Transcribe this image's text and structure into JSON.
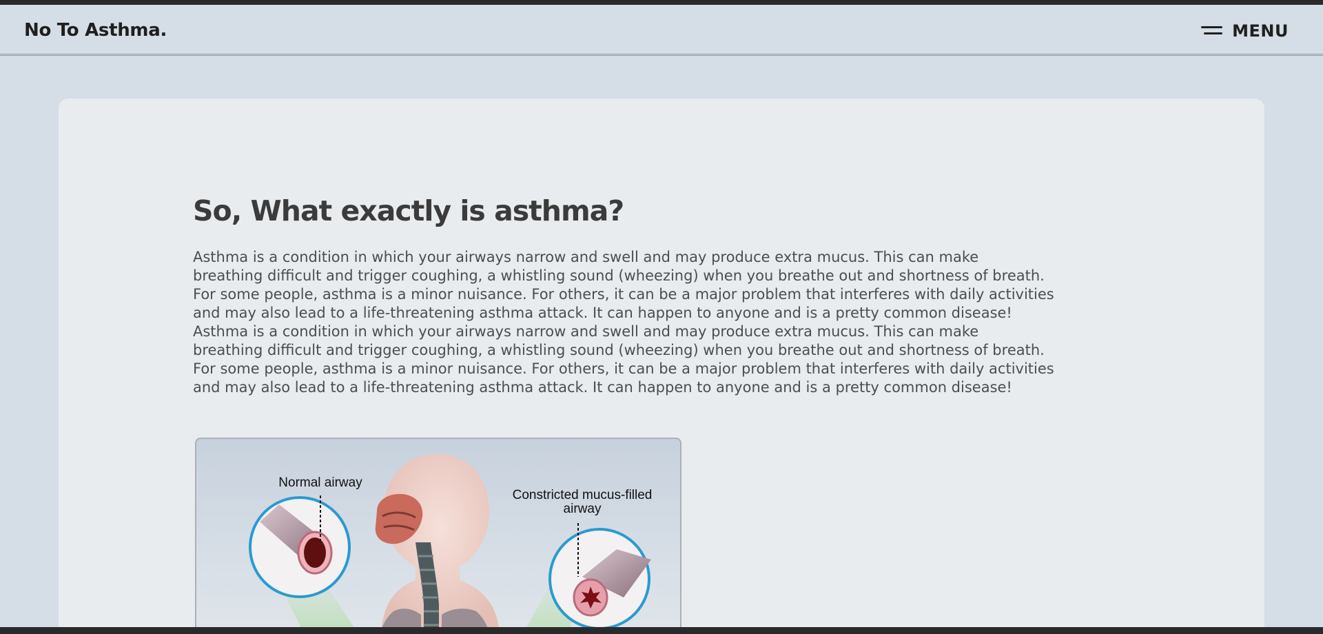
{
  "header": {
    "brand": "No To Asthma.",
    "menu_label": "MENU",
    "menu_icon": "hamburger-menu-icon"
  },
  "main": {
    "title": "So, What exactly is asthma?",
    "paragraph_lines": [
      "Asthma is a condition in which your airways narrow and swell and may produce extra mucus. This can make",
      "breathing difficult and trigger coughing, a whistling sound (wheezing) when you breathe out and shortness of breath.",
      "For some people, asthma is a minor nuisance. For others, it can be a major problem that interferes with daily activities",
      "and may also lead to a life-threatening asthma attack. It can happen to anyone and is a pretty common disease!",
      "Asthma is a condition in which your airways narrow and swell and may produce extra mucus. This can make",
      "breathing difficult and trigger coughing, a whistling sound (wheezing) when you breathe out and shortness of breath.",
      "For some people, asthma is a minor nuisance. For others, it can be a major problem that interferes with daily activities",
      "and may also lead to a life-threatening asthma attack. It can happen to anyone and is a pretty common disease!"
    ],
    "figure": {
      "label_normal": "Normal airway",
      "label_constricted": "Constricted mucus-filled airway"
    }
  },
  "colors": {
    "page_background": "#d5dde6",
    "card_background": "#e8ecef",
    "text_primary": "#3b3b3b",
    "ring_accent": "#2a9ad0"
  }
}
